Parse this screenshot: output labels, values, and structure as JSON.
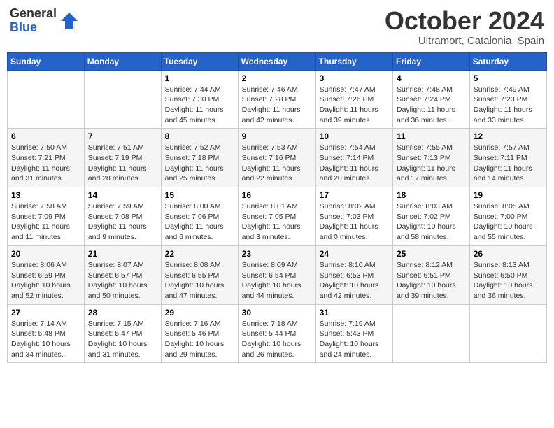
{
  "header": {
    "logo_general": "General",
    "logo_blue": "Blue",
    "title": "October 2024",
    "location": "Ultramort, Catalonia, Spain"
  },
  "weekdays": [
    "Sunday",
    "Monday",
    "Tuesday",
    "Wednesday",
    "Thursday",
    "Friday",
    "Saturday"
  ],
  "weeks": [
    [
      {
        "day": "",
        "info": ""
      },
      {
        "day": "",
        "info": ""
      },
      {
        "day": "1",
        "info": "Sunrise: 7:44 AM\nSunset: 7:30 PM\nDaylight: 11 hours and 45 minutes."
      },
      {
        "day": "2",
        "info": "Sunrise: 7:46 AM\nSunset: 7:28 PM\nDaylight: 11 hours and 42 minutes."
      },
      {
        "day": "3",
        "info": "Sunrise: 7:47 AM\nSunset: 7:26 PM\nDaylight: 11 hours and 39 minutes."
      },
      {
        "day": "4",
        "info": "Sunrise: 7:48 AM\nSunset: 7:24 PM\nDaylight: 11 hours and 36 minutes."
      },
      {
        "day": "5",
        "info": "Sunrise: 7:49 AM\nSunset: 7:23 PM\nDaylight: 11 hours and 33 minutes."
      }
    ],
    [
      {
        "day": "6",
        "info": "Sunrise: 7:50 AM\nSunset: 7:21 PM\nDaylight: 11 hours and 31 minutes."
      },
      {
        "day": "7",
        "info": "Sunrise: 7:51 AM\nSunset: 7:19 PM\nDaylight: 11 hours and 28 minutes."
      },
      {
        "day": "8",
        "info": "Sunrise: 7:52 AM\nSunset: 7:18 PM\nDaylight: 11 hours and 25 minutes."
      },
      {
        "day": "9",
        "info": "Sunrise: 7:53 AM\nSunset: 7:16 PM\nDaylight: 11 hours and 22 minutes."
      },
      {
        "day": "10",
        "info": "Sunrise: 7:54 AM\nSunset: 7:14 PM\nDaylight: 11 hours and 20 minutes."
      },
      {
        "day": "11",
        "info": "Sunrise: 7:55 AM\nSunset: 7:13 PM\nDaylight: 11 hours and 17 minutes."
      },
      {
        "day": "12",
        "info": "Sunrise: 7:57 AM\nSunset: 7:11 PM\nDaylight: 11 hours and 14 minutes."
      }
    ],
    [
      {
        "day": "13",
        "info": "Sunrise: 7:58 AM\nSunset: 7:09 PM\nDaylight: 11 hours and 11 minutes."
      },
      {
        "day": "14",
        "info": "Sunrise: 7:59 AM\nSunset: 7:08 PM\nDaylight: 11 hours and 9 minutes."
      },
      {
        "day": "15",
        "info": "Sunrise: 8:00 AM\nSunset: 7:06 PM\nDaylight: 11 hours and 6 minutes."
      },
      {
        "day": "16",
        "info": "Sunrise: 8:01 AM\nSunset: 7:05 PM\nDaylight: 11 hours and 3 minutes."
      },
      {
        "day": "17",
        "info": "Sunrise: 8:02 AM\nSunset: 7:03 PM\nDaylight: 11 hours and 0 minutes."
      },
      {
        "day": "18",
        "info": "Sunrise: 8:03 AM\nSunset: 7:02 PM\nDaylight: 10 hours and 58 minutes."
      },
      {
        "day": "19",
        "info": "Sunrise: 8:05 AM\nSunset: 7:00 PM\nDaylight: 10 hours and 55 minutes."
      }
    ],
    [
      {
        "day": "20",
        "info": "Sunrise: 8:06 AM\nSunset: 6:59 PM\nDaylight: 10 hours and 52 minutes."
      },
      {
        "day": "21",
        "info": "Sunrise: 8:07 AM\nSunset: 6:57 PM\nDaylight: 10 hours and 50 minutes."
      },
      {
        "day": "22",
        "info": "Sunrise: 8:08 AM\nSunset: 6:55 PM\nDaylight: 10 hours and 47 minutes."
      },
      {
        "day": "23",
        "info": "Sunrise: 8:09 AM\nSunset: 6:54 PM\nDaylight: 10 hours and 44 minutes."
      },
      {
        "day": "24",
        "info": "Sunrise: 8:10 AM\nSunset: 6:53 PM\nDaylight: 10 hours and 42 minutes."
      },
      {
        "day": "25",
        "info": "Sunrise: 8:12 AM\nSunset: 6:51 PM\nDaylight: 10 hours and 39 minutes."
      },
      {
        "day": "26",
        "info": "Sunrise: 8:13 AM\nSunset: 6:50 PM\nDaylight: 10 hours and 36 minutes."
      }
    ],
    [
      {
        "day": "27",
        "info": "Sunrise: 7:14 AM\nSunset: 5:48 PM\nDaylight: 10 hours and 34 minutes."
      },
      {
        "day": "28",
        "info": "Sunrise: 7:15 AM\nSunset: 5:47 PM\nDaylight: 10 hours and 31 minutes."
      },
      {
        "day": "29",
        "info": "Sunrise: 7:16 AM\nSunset: 5:46 PM\nDaylight: 10 hours and 29 minutes."
      },
      {
        "day": "30",
        "info": "Sunrise: 7:18 AM\nSunset: 5:44 PM\nDaylight: 10 hours and 26 minutes."
      },
      {
        "day": "31",
        "info": "Sunrise: 7:19 AM\nSunset: 5:43 PM\nDaylight: 10 hours and 24 minutes."
      },
      {
        "day": "",
        "info": ""
      },
      {
        "day": "",
        "info": ""
      }
    ]
  ]
}
